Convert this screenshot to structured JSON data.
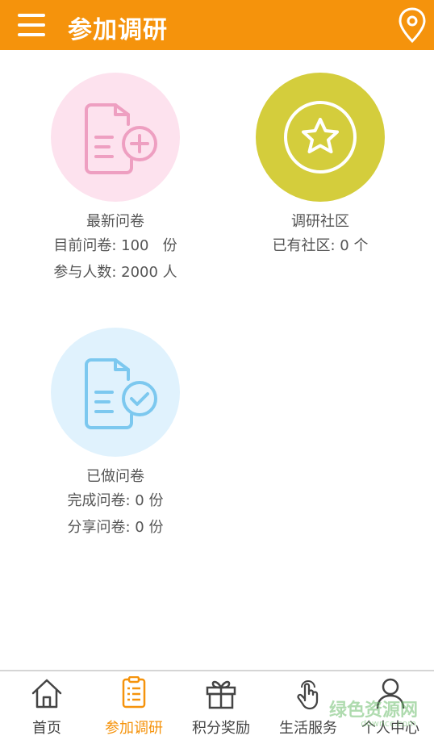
{
  "header": {
    "title": "参加调研",
    "bg_color": "#f5930c",
    "menu_icon": "hamburger-menu-icon",
    "location_icon": "location-pin-icon"
  },
  "cards": [
    {
      "title": "最新问卷",
      "lines": [
        "目前问卷: 100   份",
        "参与人数: 2000 人"
      ],
      "icon": "new-survey-icon",
      "circle_color": "#fde2ee",
      "icon_color": "#ee9fc1"
    },
    {
      "title": "调研社区",
      "lines": [
        "已有社区: 0 个"
      ],
      "icon": "star-icon",
      "circle_color": "#d4cd3c",
      "icon_color": "#ffffff"
    },
    {
      "title": "已做问卷",
      "lines": [
        "完成问卷: 0 份",
        "分享问卷: 0 份"
      ],
      "icon": "completed-survey-icon",
      "circle_color": "#e0f2fd",
      "icon_color": "#7cc8ef"
    }
  ],
  "tabbar": {
    "items": [
      {
        "label": "首页",
        "icon": "home-icon",
        "active": false
      },
      {
        "label": "参加调研",
        "icon": "survey-list-icon",
        "active": true
      },
      {
        "label": "积分奖励",
        "icon": "gift-icon",
        "active": false
      },
      {
        "label": "生活服务",
        "icon": "touch-hand-icon",
        "active": false
      },
      {
        "label": "个人中心",
        "icon": "person-icon",
        "active": false
      }
    ],
    "active_color": "#f5930c"
  },
  "watermark": {
    "text": "绿色资源网",
    "sub": "downcc.com"
  }
}
